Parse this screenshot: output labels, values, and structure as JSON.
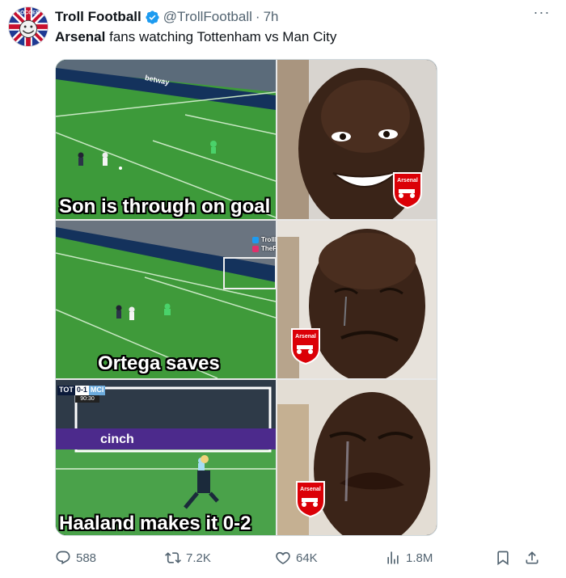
{
  "tweet": {
    "display_name": "Troll Football",
    "handle": "@TrollFootball",
    "separator": "·",
    "time": "7h",
    "text_bold": "Arsenal",
    "text_rest": " fans watching Tottenham vs Man City",
    "more_label": "···"
  },
  "meme": {
    "captions": [
      "Son is through on goal",
      "Ortega saves",
      "Haaland makes it 0-2"
    ],
    "watermark_twitter": "TrollFootball",
    "watermark_instagram": "TheFootballTroll",
    "badge_text": "Arsenal",
    "board_text_1": "betway",
    "board_text_2": "cinch",
    "scorebug": {
      "home": "TOT",
      "score": "0-1",
      "away": "MCI",
      "time": "90:30"
    },
    "avatar_text": "SOCCER"
  },
  "stats": {
    "replies": "588",
    "retweets": "7.2K",
    "likes": "64K",
    "views": "1.8M"
  },
  "colors": {
    "verified": "#1d9bf0",
    "muted": "#536471",
    "pitch": "#3f9a3a",
    "arsenal_red": "#db0007"
  }
}
